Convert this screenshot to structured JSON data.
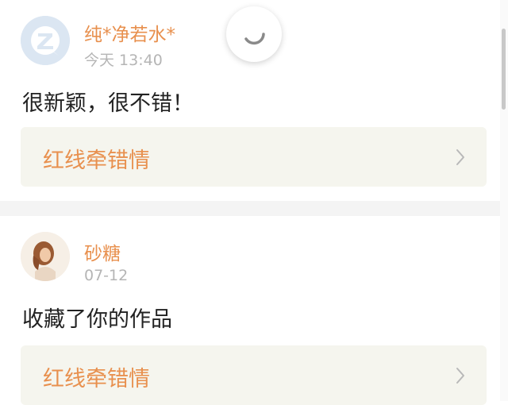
{
  "comments": [
    {
      "user": "纯*净若水*",
      "time": "今天 13:40",
      "text": "很新颖，很不错！",
      "work_title": "红线牵错情",
      "avatar_icon": "default-avatar-icon"
    },
    {
      "user": "砂糖",
      "time": "07-12",
      "text": "收藏了你的作品",
      "work_title": "红线牵错情",
      "avatar_icon": "user-photo-avatar"
    }
  ],
  "colors": {
    "username": "#e8904e",
    "time": "#b5b5b5",
    "work_card_bg": "#f5f5ee"
  }
}
